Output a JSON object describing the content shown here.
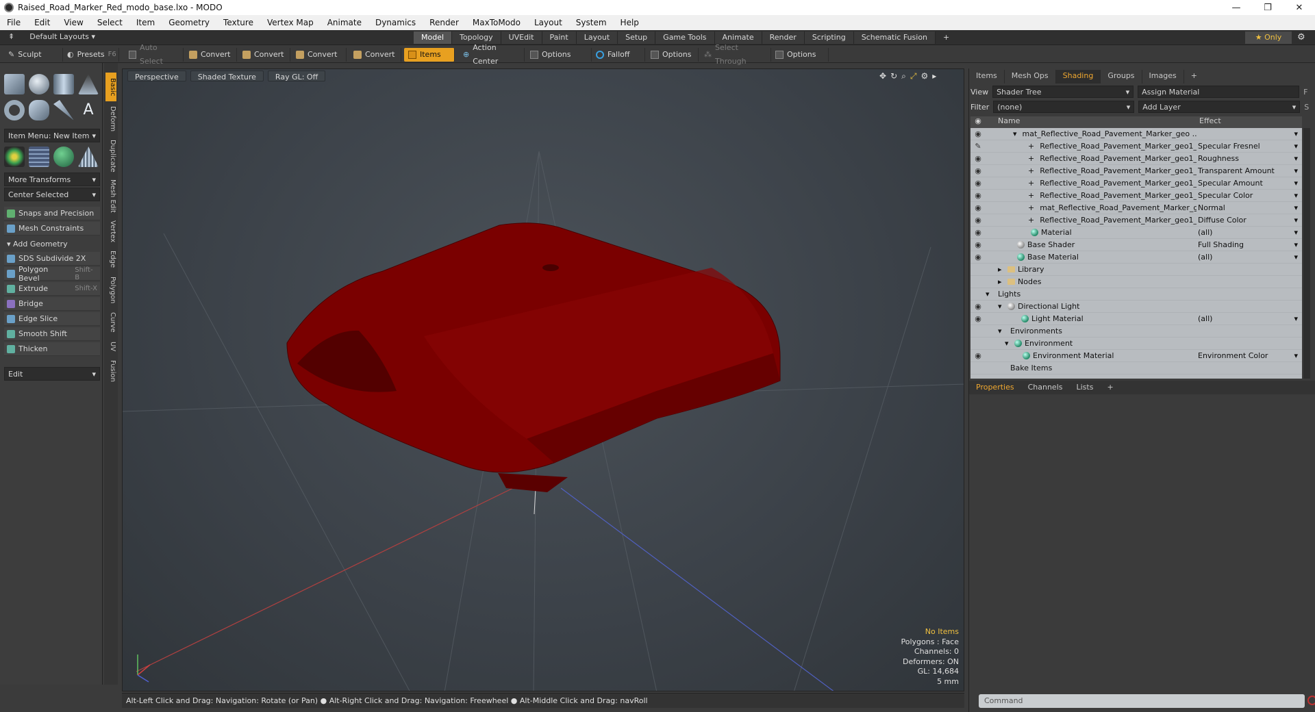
{
  "window": {
    "title": "Raised_Road_Marker_Red_modo_base.lxo - MODO",
    "minimize": "—",
    "restore": "❐",
    "close": "✕"
  },
  "menu": [
    "File",
    "Edit",
    "View",
    "Select",
    "Item",
    "Geometry",
    "Texture",
    "Vertex Map",
    "Animate",
    "Dynamics",
    "Render",
    "MaxToModo",
    "Layout",
    "System",
    "Help"
  ],
  "layout": {
    "selector": "Default Layouts ▾",
    "tabs": [
      "Model",
      "Topology",
      "UVEdit",
      "Paint",
      "Layout",
      "Setup",
      "Game Tools",
      "Animate",
      "Render",
      "Scripting",
      "Schematic Fusion",
      "+"
    ],
    "active_tab": "Model",
    "only": "★  Only"
  },
  "toolbar": {
    "sculpt": "Sculpt",
    "presets": "Presets",
    "presets_key": "F6",
    "auto_select": "Auto Select",
    "convert1": "Convert",
    "convert2": "Convert",
    "convert3": "Convert",
    "convert4": "Convert",
    "items": "Items",
    "action_center": "Action Center",
    "options1": "Options",
    "falloff": "Falloff",
    "options2": "Options",
    "select_through": "Select Through",
    "options3": "Options"
  },
  "left": {
    "item_menu": "Item Menu: New Item",
    "more_transforms": "More Transforms",
    "center_selected": "Center Selected",
    "snaps": "Snaps and Precision",
    "mesh_constraints": "Mesh Constraints",
    "add_geometry": "Add Geometry",
    "tools": [
      {
        "label": "SDS Subdivide 2X",
        "key": ""
      },
      {
        "label": "Polygon Bevel",
        "key": "Shift-B"
      },
      {
        "label": "Extrude",
        "key": "Shift-X"
      },
      {
        "label": "Bridge",
        "key": ""
      },
      {
        "label": "Edge Slice",
        "key": ""
      },
      {
        "label": "Smooth Shift",
        "key": ""
      },
      {
        "label": "Thicken",
        "key": ""
      }
    ],
    "edit": "Edit",
    "side_tabs": [
      "Basic",
      "Deform",
      "Duplicate",
      "Mesh Edit",
      "Vertex",
      "Edge",
      "Polygon",
      "Curve",
      "UV",
      "Fusion"
    ]
  },
  "viewport": {
    "tabs": [
      "Perspective",
      "Shaded Texture",
      "Ray GL: Off"
    ],
    "stats": {
      "no_items": "No Items",
      "polygons": "Polygons : Face",
      "channels": "Channels: 0",
      "deformers": "Deformers: ON",
      "gl": "GL: 14,684",
      "size": "5 mm"
    },
    "status": "Alt-Left Click and Drag: Navigation: Rotate (or Pan) ● Alt-Right Click and Drag: Navigation: Freewheel ● Alt-Middle Click and Drag: navRoll",
    "model_color": "#7a0000"
  },
  "right": {
    "tabs": [
      "Items",
      "Mesh Ops",
      "Shading",
      "Groups",
      "Images",
      "+"
    ],
    "active_tab": "Shading",
    "view_label": "View",
    "view_value": "Shader Tree",
    "assign_material": "Assign Material",
    "assign_key": "F",
    "filter_label": "Filter",
    "filter_value": "(none)",
    "add_layer": "Add Layer",
    "add_layer_key": "S",
    "col_name": "Name",
    "col_effect": "Effect",
    "tree": [
      {
        "name": "mat_Reflective_Road_Pavement_Marker_geo ...",
        "effect": "",
        "eye": true,
        "icon": "red"
      },
      {
        "name": "Reflective_Road_Pavement_Marker_geo1_ ...",
        "effect": "Specular Fresnel",
        "eye": false,
        "icon": "dark"
      },
      {
        "name": "Reflective_Road_Pavement_Marker_geo1_ ...",
        "effect": "Roughness",
        "eye": true,
        "icon": "dark"
      },
      {
        "name": "Reflective_Road_Pavement_Marker_geo1_ ...",
        "effect": "Transparent Amount",
        "eye": true,
        "icon": "dark"
      },
      {
        "name": "Reflective_Road_Pavement_Marker_geo1_ ...",
        "effect": "Specular Amount",
        "eye": true,
        "icon": "dark"
      },
      {
        "name": "Reflective_Road_Pavement_Marker_geo1_ ...",
        "effect": "Specular Color",
        "eye": true,
        "icon": "dark"
      },
      {
        "name": "mat_Reflective_Road_Pavement_Marker_g ...",
        "effect": "Normal",
        "eye": true,
        "icon": "dark"
      },
      {
        "name": "Reflective_Road_Pavement_Marker_geo1_r...",
        "effect": "Diffuse Color",
        "eye": true,
        "icon": "dark"
      },
      {
        "name": "Material",
        "effect": "(all)",
        "eye": true,
        "icon": "green"
      },
      {
        "name": "Base Shader",
        "effect": "Full Shading",
        "eye": true,
        "icon": "grey"
      },
      {
        "name": "Base Material",
        "effect": "(all)",
        "eye": true,
        "icon": "green"
      },
      {
        "name": "Library",
        "effect": "",
        "eye": false,
        "icon": "folder"
      },
      {
        "name": "Nodes",
        "effect": "",
        "eye": false,
        "icon": "folder"
      },
      {
        "name": "Lights",
        "effect": "",
        "eye": false,
        "icon": "none"
      },
      {
        "name": "Directional Light",
        "effect": "",
        "eye": true,
        "icon": "light"
      },
      {
        "name": "Light Material",
        "effect": "(all)",
        "eye": true,
        "icon": "green"
      },
      {
        "name": "Environments",
        "effect": "",
        "eye": false,
        "icon": "none"
      },
      {
        "name": "Environment",
        "effect": "",
        "eye": false,
        "icon": "env"
      },
      {
        "name": "Environment Material",
        "effect": "Environment Color",
        "eye": true,
        "icon": "green"
      },
      {
        "name": "Bake Items",
        "effect": "",
        "eye": false,
        "icon": "none"
      }
    ],
    "prop_tabs": [
      "Properties",
      "Channels",
      "Lists",
      "+"
    ],
    "active_prop_tab": "Properties",
    "command_placeholder": "Command"
  }
}
